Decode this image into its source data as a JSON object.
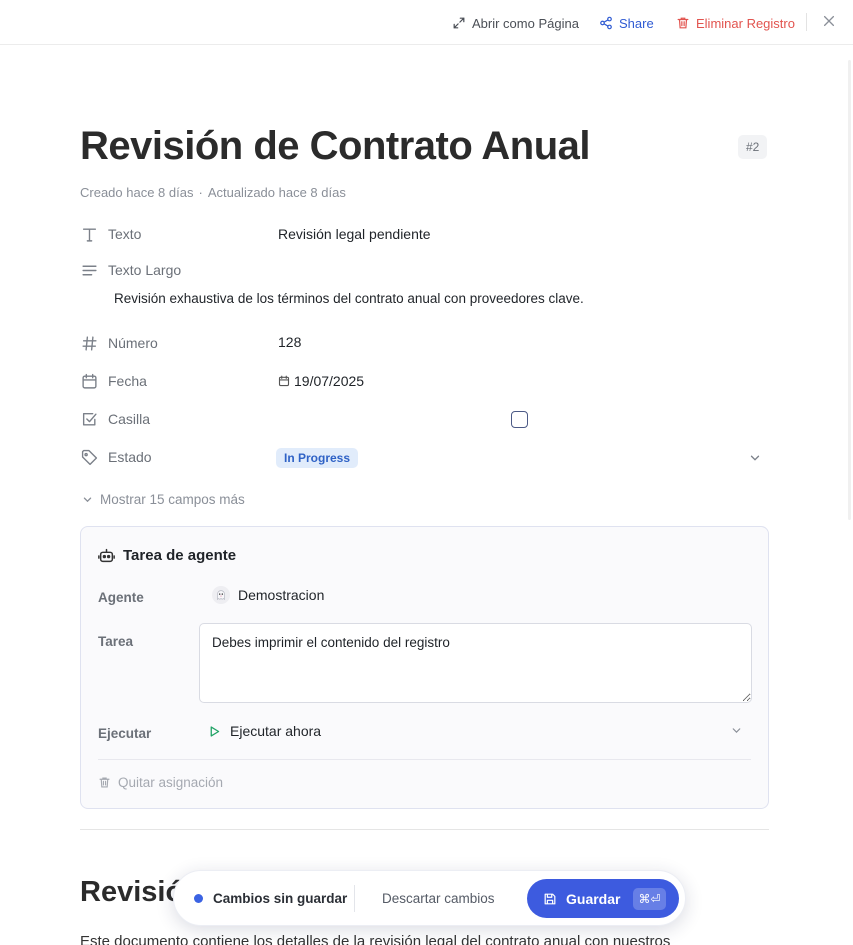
{
  "topbar": {
    "open_page": "Abrir como Página",
    "share": "Share",
    "delete": "Eliminar Registro"
  },
  "record": {
    "title": "Revisión de Contrato Anual",
    "id_badge": "#2",
    "created": "Creado hace 8 días",
    "separator": "·",
    "updated": "Actualizado hace 8 días"
  },
  "properties": {
    "texto": {
      "label": "Texto",
      "value": "Revisión legal pendiente",
      "icon": "text-type-icon"
    },
    "texto_largo": {
      "label": "Texto Largo",
      "value": "Revisión exhaustiva de los términos del contrato anual con proveedores clave.",
      "icon": "long-text-icon"
    },
    "numero": {
      "label": "Número",
      "value": "128",
      "icon": "hash-icon"
    },
    "fecha": {
      "label": "Fecha",
      "value": "19/07/2025",
      "icon": "calendar-icon"
    },
    "casilla": {
      "label": "Casilla",
      "checked": false,
      "icon": "checkbox-icon"
    },
    "estado": {
      "label": "Estado",
      "value": "In Progress",
      "icon": "tag-icon",
      "color": "#2f62c6"
    }
  },
  "show_more": "Mostrar 15 campos más",
  "agent_task": {
    "title": "Tarea de agente",
    "agent_label": "Agente",
    "agent_name": "Demostracion",
    "task_label": "Tarea",
    "task_value": "Debes imprimir el contenido del registro",
    "execute_label": "Ejecutar",
    "execute_value": "Ejecutar ahora",
    "unassign": "Quitar asignación"
  },
  "document": {
    "heading": "Revisión",
    "paragraph": "Este documento contiene los detalles de la revisión legal del contrato anual con nuestros"
  },
  "savebar": {
    "status": "Cambios sin guardar",
    "discard": "Descartar cambios",
    "save": "Guardar",
    "shortcut": "⌘⏎"
  },
  "colors": {
    "accent": "#3d5bdf",
    "danger": "#e2544f",
    "link": "#2f5bd3"
  }
}
